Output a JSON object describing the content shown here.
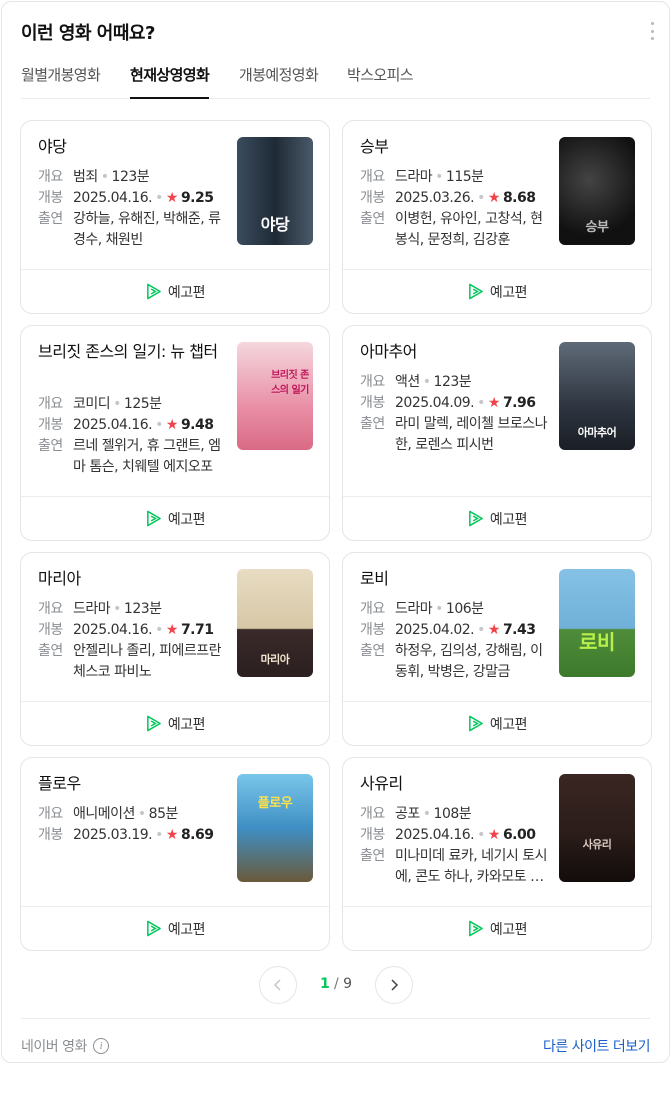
{
  "header": {
    "title": "이런 영화 어때요?"
  },
  "tabs": [
    {
      "label": "월별개봉영화"
    },
    {
      "label": "현재상영영화"
    },
    {
      "label": "개봉예정영화"
    },
    {
      "label": "박스오피스"
    }
  ],
  "labels": {
    "genre": "개요",
    "release": "개봉",
    "cast": "출연",
    "trailer": "예고편"
  },
  "movies": [
    {
      "title": "야당",
      "genre": "범죄",
      "runtime": "123분",
      "release": "2025.04.16.",
      "rating": "9.25",
      "cast": "강하늘, 유해진, 박해준, 류경수, 채원빈",
      "poster_text": "야당",
      "poster_color": "#2a3a4a"
    },
    {
      "title": "승부",
      "genre": "드라마",
      "runtime": "115분",
      "release": "2025.03.26.",
      "rating": "8.68",
      "cast": "이병헌, 유아인, 고창석, 현봉식, 문정희, 김강훈",
      "poster_text": "승부",
      "poster_color": "#1e1e1e"
    },
    {
      "title": "브리짓 존스의 일기: 뉴 챕터",
      "genre": "코미디",
      "runtime": "125분",
      "release": "2025.04.16.",
      "rating": "9.48",
      "cast": "르네 젤위거, 휴 그랜트, 엠마 톰슨, 치웨텔 에지오포",
      "poster_text": "브리짓 존스의 일기",
      "poster_color": "#e98fa6"
    },
    {
      "title": "아마추어",
      "genre": "액션",
      "runtime": "123분",
      "release": "2025.04.09.",
      "rating": "7.96",
      "cast": "라미 말렉, 레이첼 브로스나한, 로렌스 피시번",
      "poster_text": "아마추어",
      "poster_color": "#3a4350"
    },
    {
      "title": "마리아",
      "genre": "드라마",
      "runtime": "123분",
      "release": "2025.04.16.",
      "rating": "7.71",
      "cast": "안젤리나 졸리, 피에르프란체스코 파비노",
      "poster_text": "마리아",
      "poster_color": "#d8ccb2"
    },
    {
      "title": "로비",
      "genre": "드라마",
      "runtime": "106분",
      "release": "2025.04.02.",
      "rating": "7.43",
      "cast": "하정우, 김의성, 강해림, 이동휘, 박병은, 강말금",
      "poster_text": "로비",
      "poster_color": "#6fb0d8"
    },
    {
      "title": "플로우",
      "genre": "애니메이션",
      "runtime": "85분",
      "release": "2025.03.19.",
      "rating": "8.69",
      "cast": "",
      "poster_text": "플로우",
      "poster_color": "#3f8fc4"
    },
    {
      "title": "사유리",
      "genre": "공포",
      "runtime": "108분",
      "release": "2025.04.16.",
      "rating": "6.00",
      "cast": "미나미데 료카, 네기시 토시에, 콘도 하나, 카와모토 타카시",
      "poster_text": "사유리",
      "poster_color": "#2b1d1a"
    }
  ],
  "pagination": {
    "current": "1",
    "separator": "/",
    "total": "9"
  },
  "footer": {
    "source": "네이버 영화",
    "info_icon": "i",
    "more_link": "다른 사이트 더보기"
  },
  "colors": {
    "accent": "#03c75a",
    "rating_star": "#f0444a",
    "link": "#1a5fc9"
  }
}
